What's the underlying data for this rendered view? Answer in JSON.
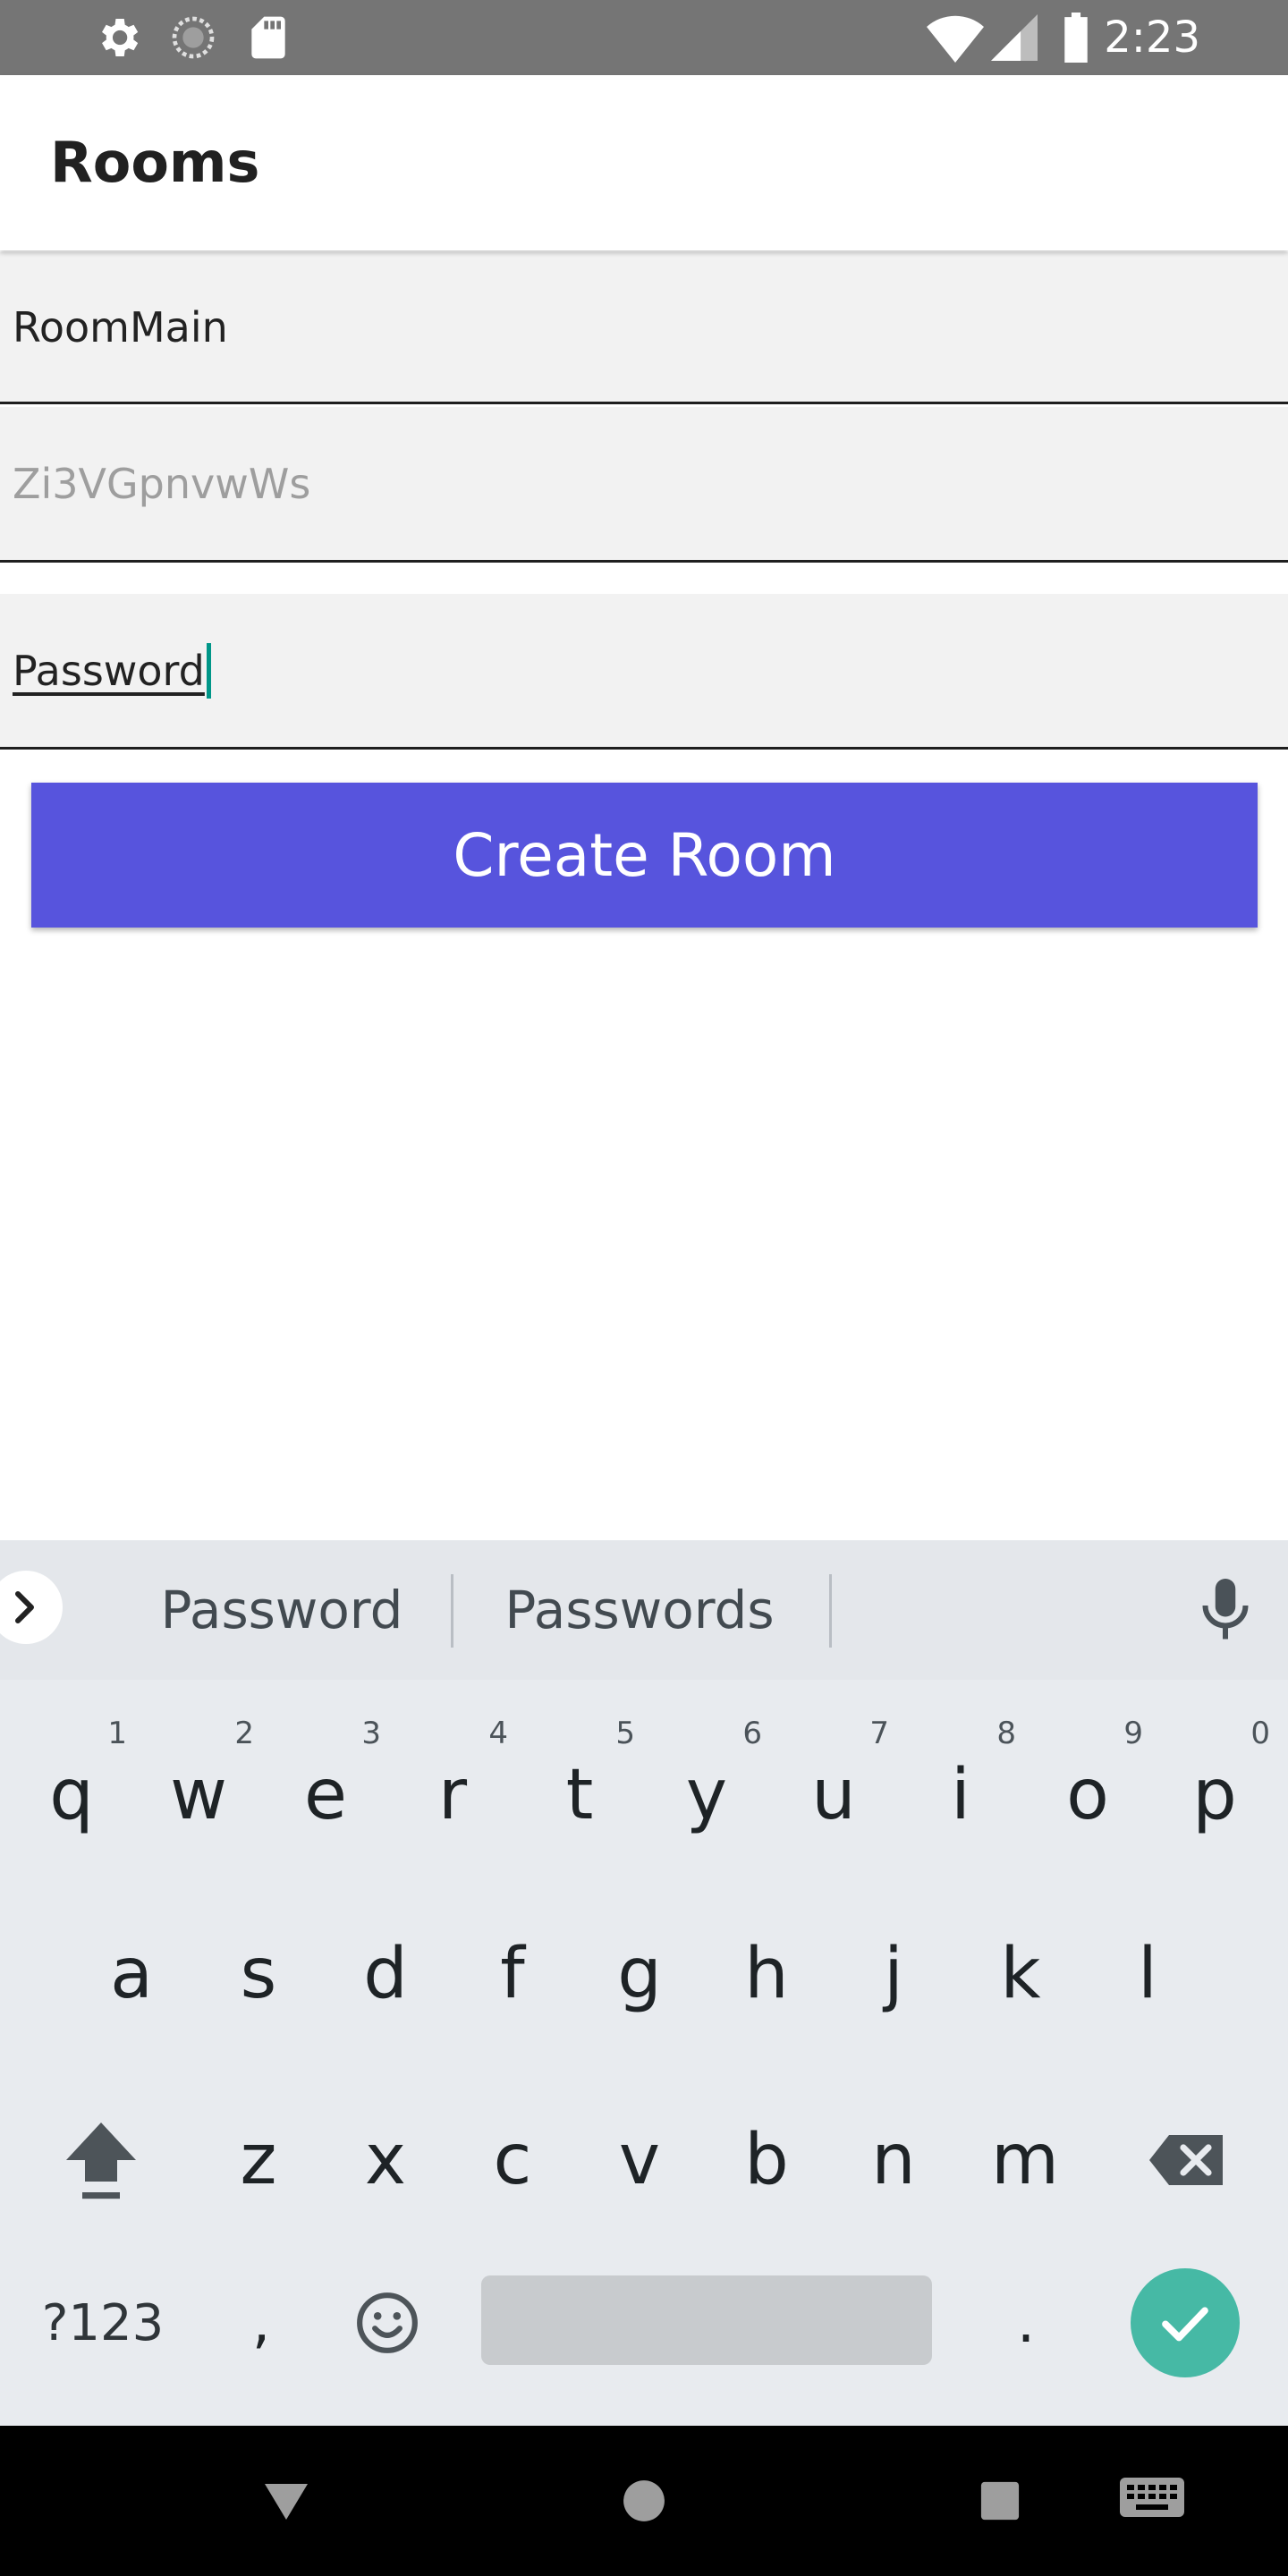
{
  "status_bar": {
    "time": "2:23",
    "left_icons": [
      "settings-icon",
      "sync-icon",
      "sd-card-icon"
    ],
    "right_icons": [
      "wifi-icon",
      "cellular-signal-icon",
      "battery-icon"
    ]
  },
  "app_bar": {
    "title": "Rooms"
  },
  "form": {
    "room_name_value": "RoomMain",
    "room_id_placeholder": "Zi3VGpnvwWs",
    "password_value": "Password",
    "create_button_label": "Create Room"
  },
  "keyboard": {
    "suggestions": [
      "Password",
      "Passwords"
    ],
    "row1": [
      {
        "key": "q",
        "hint": "1"
      },
      {
        "key": "w",
        "hint": "2"
      },
      {
        "key": "e",
        "hint": "3"
      },
      {
        "key": "r",
        "hint": "4"
      },
      {
        "key": "t",
        "hint": "5"
      },
      {
        "key": "y",
        "hint": "6"
      },
      {
        "key": "u",
        "hint": "7"
      },
      {
        "key": "i",
        "hint": "8"
      },
      {
        "key": "o",
        "hint": "9"
      },
      {
        "key": "p",
        "hint": "0"
      }
    ],
    "row2": [
      "a",
      "s",
      "d",
      "f",
      "g",
      "h",
      "j",
      "k",
      "l"
    ],
    "row3": [
      "z",
      "x",
      "c",
      "v",
      "b",
      "n",
      "m"
    ],
    "symbols_label": "?123",
    "comma": ",",
    "period": "."
  },
  "colors": {
    "accent": "#5754dd",
    "status_bar": "#757575",
    "cursor": "#009688",
    "done_button": "#46b9a5"
  }
}
